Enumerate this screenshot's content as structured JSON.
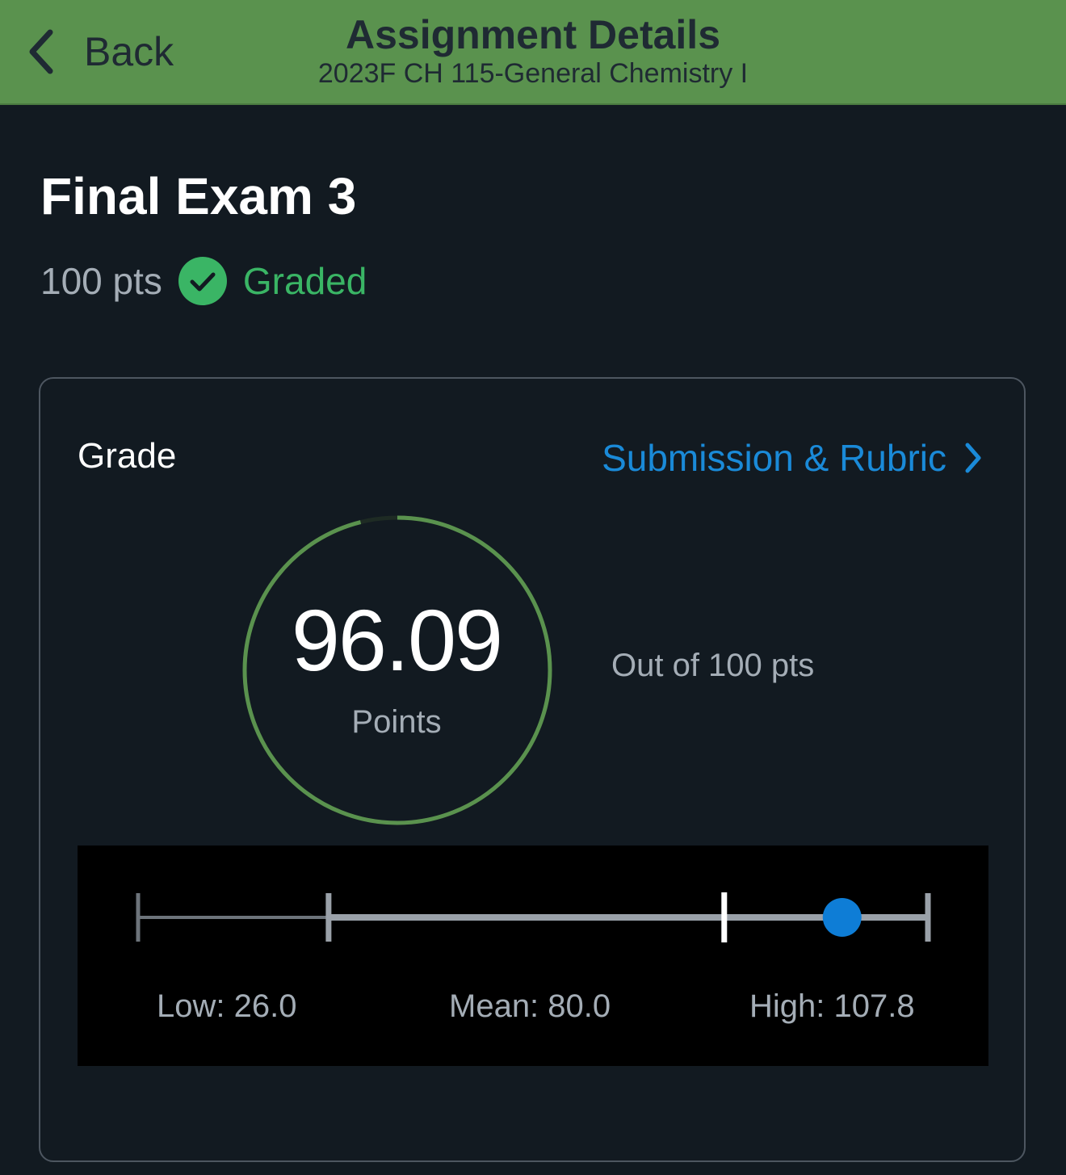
{
  "header": {
    "back_label": "Back",
    "title": "Assignment Details",
    "course": "2023F CH 115-General Chemistry I"
  },
  "assignment": {
    "title": "Final Exam 3",
    "points_possible": "100 pts",
    "status": "Graded"
  },
  "grade": {
    "label": "Grade",
    "link_label": "Submission & Rubric",
    "score": "96.09",
    "score_value": 96.09,
    "max_value": 100,
    "unit_label": "Points",
    "out_of": "Out of 100 pts"
  },
  "stats": {
    "low_label": "Low: 26.0",
    "mean_label": "Mean: 80.0",
    "high_label": "High: 107.8",
    "low": 26.0,
    "mean": 80.0,
    "high": 107.8,
    "score": 96.09
  },
  "colors": {
    "header_bg": "#5a924e",
    "page_bg": "#121a21",
    "accent_green": "#3ab565",
    "ring_green": "#5a924e",
    "link_blue": "#1a8ad8",
    "marker_blue": "#0e7dd6"
  },
  "icons": {
    "back": "chevron-left-icon",
    "graded": "check-circle-icon",
    "link": "chevron-right-icon"
  }
}
